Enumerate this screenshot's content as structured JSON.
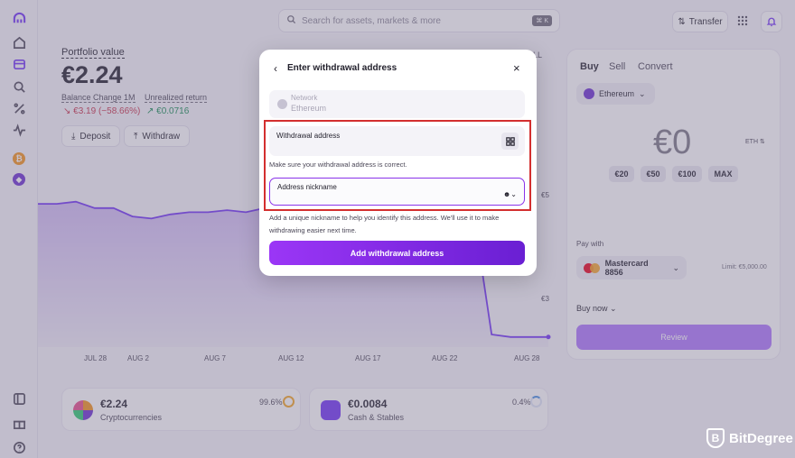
{
  "search": {
    "placeholder": "Search for assets, markets & more",
    "shortcut": "⌘ K"
  },
  "topbar": {
    "transfer_label": "Transfer"
  },
  "portfolio": {
    "label": "Portfolio value",
    "value": "€2.24",
    "balance_change_label": "Balance Change 1M",
    "balance_change_value": "↘ €3.19 (−58.66%)",
    "unrealized_label": "Unrealized return",
    "unrealized_value": "↗ €0.0716",
    "deposit_label": "Deposit",
    "withdraw_label": "Withdraw",
    "all_tab": "LL"
  },
  "chart_data": {
    "type": "area",
    "x_ticks": [
      "JUL 28",
      "AUG 2",
      "AUG 7",
      "AUG 12",
      "AUG 17",
      "AUG 22",
      "AUG 28"
    ],
    "y_ticks": [
      "€5",
      "€3"
    ],
    "series": [
      {
        "values": [
          5.4,
          5.4,
          5.45,
          5.3,
          5.3,
          5.1,
          5.05,
          5.15,
          5.2,
          5.2,
          5.25,
          5.2,
          5.3,
          5.3,
          5.3,
          5.3,
          5.35,
          5.4,
          5.35,
          5.4,
          5.4,
          5.3,
          5.35,
          5.3,
          2.3,
          2.24,
          2.24,
          2.24
        ]
      }
    ]
  },
  "cards": [
    {
      "value": "€2.24",
      "label": "Cryptocurrencies",
      "percent": "99.6%"
    },
    {
      "value": "€0.0084",
      "label": "Cash & Stables",
      "percent": "0.4%"
    }
  ],
  "trade": {
    "tabs": [
      "Buy",
      "Sell",
      "Convert"
    ],
    "asset": "Ethereum",
    "amount": "€0",
    "unit": "ETH",
    "quick": [
      "€20",
      "€50",
      "€100",
      "MAX"
    ],
    "pay_with_label": "Pay with",
    "card": "Mastercard 8856",
    "limit": "Limit: €5,000.00",
    "buy_now": "Buy now",
    "review": "Review"
  },
  "modal": {
    "title": "Enter withdrawal address",
    "network_label": "Network",
    "network_value": "Ethereum",
    "address_label": "Withdrawal address",
    "address_hint": "Make sure your withdrawal address is correct.",
    "nickname_label": "Address nickname",
    "nickname_hint": "Add a unique nickname to help you identify this address. We'll use it to make withdrawing easier next time.",
    "submit": "Add withdrawal address"
  },
  "watermark": "BitDegree",
  "colors": {
    "accent": "#7132f5",
    "highlight": "#d32f2f",
    "negative": "#c8324a",
    "positive": "#188d53"
  }
}
